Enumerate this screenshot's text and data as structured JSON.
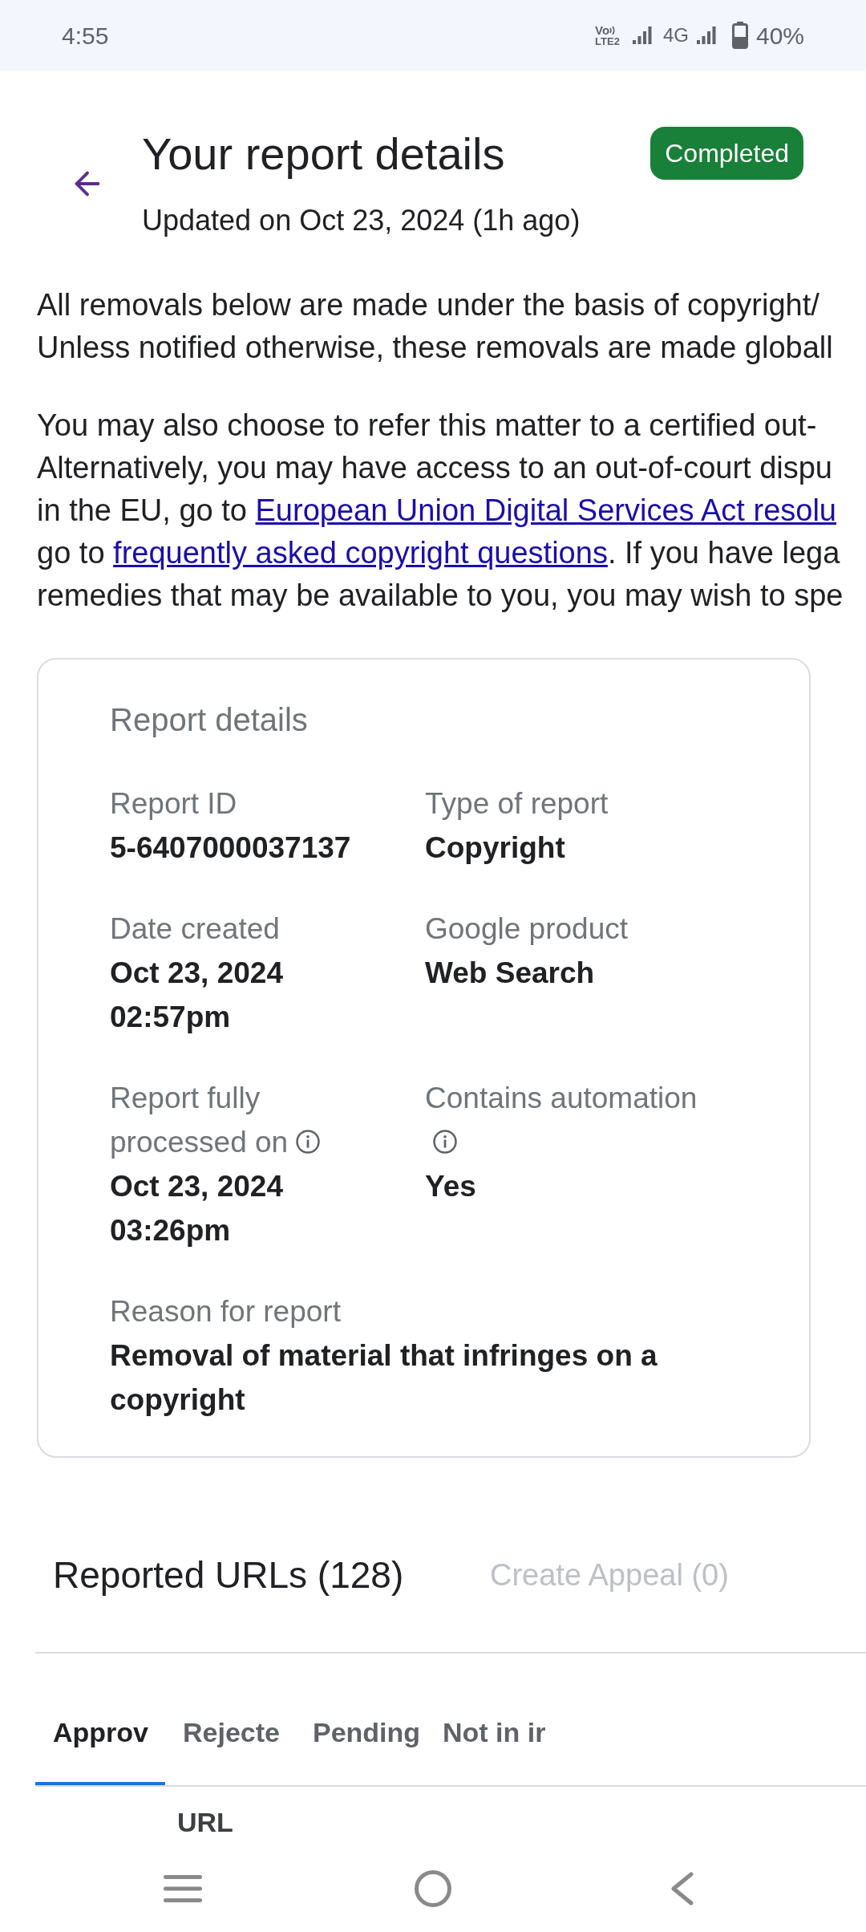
{
  "status_bar": {
    "time": "4:55",
    "volte": {
      "top": "Vo",
      "bottom": "LTE2"
    },
    "network_type": "4G",
    "battery": "40%"
  },
  "header": {
    "title": "Your report details",
    "subtitle": "Updated on Oct 23, 2024 (1h ago)",
    "status": {
      "label": "Completed",
      "kind": "completed"
    }
  },
  "notice": [
    {
      "lines": [
        [
          {
            "kind": "text",
            "text": "All removals below are made under the basis of copyright/"
          }
        ],
        [
          {
            "kind": "text",
            "text": "Unless notified otherwise, these removals are made globall"
          }
        ]
      ]
    },
    {
      "lines": [
        [
          {
            "kind": "text",
            "text": "You may also choose to refer this matter to a certified out-"
          }
        ],
        [
          {
            "kind": "text",
            "text": "Alternatively, you may have access to an out-of-court dispu"
          }
        ],
        [
          {
            "kind": "text",
            "text": "in the EU, go to "
          },
          {
            "kind": "link",
            "text": "European Union Digital Services Act resolu"
          }
        ],
        [
          {
            "kind": "text",
            "text": "go to "
          },
          {
            "kind": "link",
            "text": "frequently asked copyright questions"
          },
          {
            "kind": "text",
            "text": ". If you have lega"
          }
        ],
        [
          {
            "kind": "text",
            "text": "remedies that may be available to you, you may wish to spe"
          }
        ]
      ]
    }
  ],
  "report_details": {
    "title": "Report details",
    "fields": [
      {
        "label": "Report ID",
        "value": "5-6407000037137",
        "info": false
      },
      {
        "label": "Type of report",
        "value": "Copyright",
        "info": false
      },
      {
        "label": "Date created",
        "value": "Oct 23, 2024 02:57pm",
        "info": false
      },
      {
        "label": "Google product",
        "value": "Web Search",
        "info": false
      },
      {
        "label": "Report fully processed on",
        "value": "Oct 23, 2024 03:26pm",
        "info": true
      },
      {
        "label": "Contains automation",
        "value": "Yes",
        "info": true
      }
    ],
    "reason": {
      "label": "Reason for report",
      "value": "Removal of material that infringes on a copyright"
    }
  },
  "reported_urls": {
    "title": "Reported URLs (128)",
    "appeal_button": {
      "label": "Create Appeal (0)",
      "disabled": true
    }
  },
  "tabs": [
    {
      "label": "Approv",
      "selected": true
    },
    {
      "label": "Rejecte",
      "selected": false
    },
    {
      "label": "Pending",
      "selected": false
    },
    {
      "label": "Not in ir",
      "selected": false
    }
  ],
  "table": {
    "columns": [
      "URL"
    ]
  }
}
